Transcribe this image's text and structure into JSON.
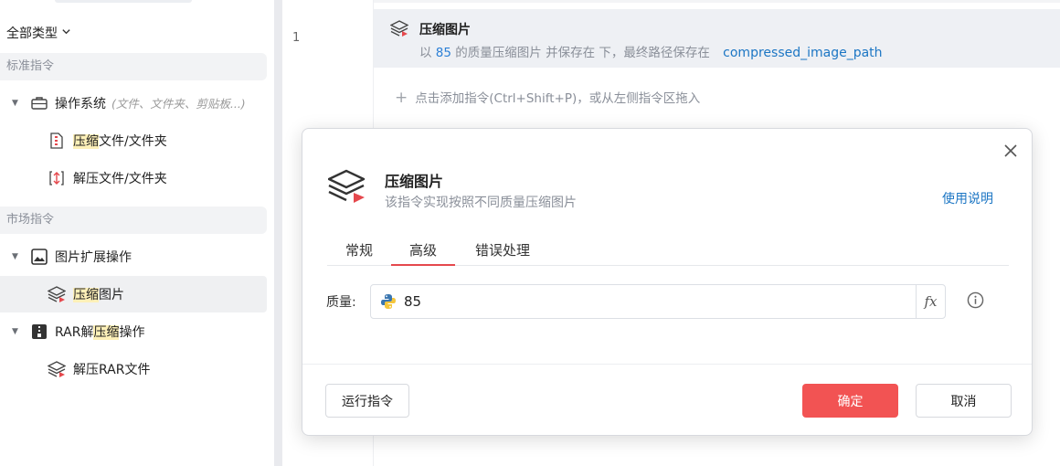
{
  "sidebar": {
    "filter_label": "全部类型",
    "sections": {
      "standard": "标准指令",
      "market": "市场指令"
    },
    "os_group": {
      "label": "操作系统",
      "hint": "(文件、文件夹、剪贴板...)"
    },
    "compress_item": {
      "hl": "压缩",
      "rest": "文件/文件夹"
    },
    "decompress_item": {
      "label": "解压文件/文件夹"
    },
    "image_group": {
      "label": "图片扩展操作"
    },
    "compress_image_item": {
      "hl": "压缩",
      "rest": "图片"
    },
    "rar_group": {
      "pre": "RAR解",
      "hl": "压缩",
      "post": "操作"
    },
    "unrar_item": {
      "label": "解压RAR文件"
    }
  },
  "editor": {
    "line_number": "1",
    "step": {
      "title": "压缩图片",
      "desc_pre": "以",
      "quality": "85",
      "desc_mid": "的质量压缩图片  并保存在  下，最终路径保存在",
      "var_name": "compressed_image_path"
    },
    "add_hint": "点击添加指令(Ctrl+Shift+P)，或从左侧指令区拖入"
  },
  "modal": {
    "title": "压缩图片",
    "subtitle": "该指令实现按照不同质量压缩图片",
    "usage_link": "使用说明",
    "tabs": [
      "常规",
      "高级",
      "错误处理"
    ],
    "active_tab": "高级",
    "quality_label": "质量:",
    "quality_value": "85",
    "fx_label": "fx",
    "run_button": "运行指令",
    "ok_button": "确定",
    "cancel_button": "取消",
    "accent_color": "#f25353"
  }
}
